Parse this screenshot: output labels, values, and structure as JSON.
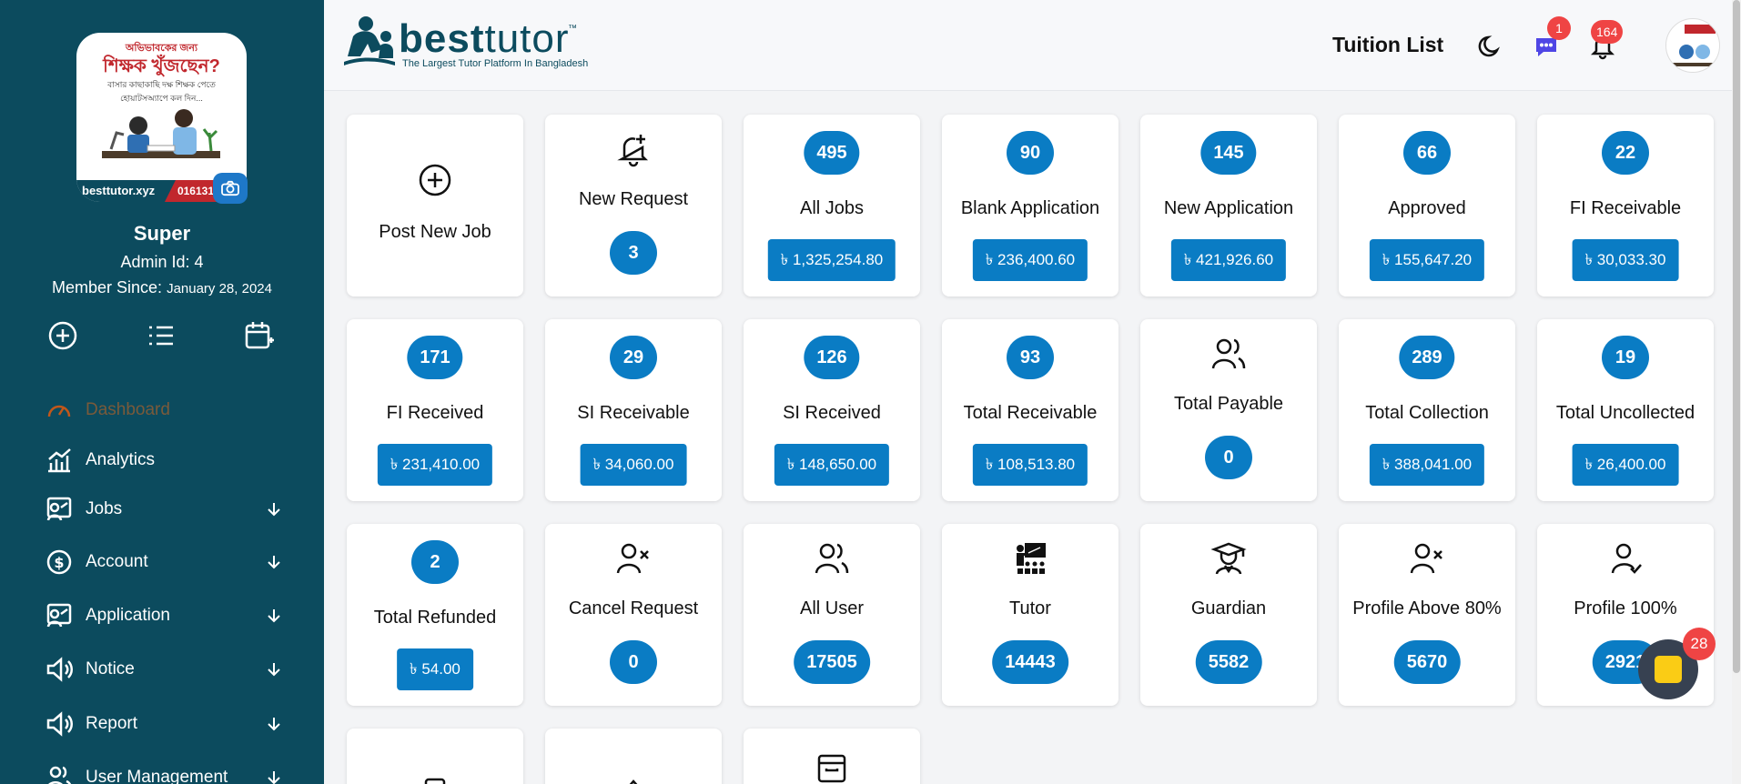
{
  "sidebar": {
    "photo": {
      "headline": "অভিভাবকের জন্য",
      "title": "শিক্ষক খুঁজছেন?",
      "subtitle": "বাসার কাছাকাছি দক্ষ শিক্ষক পেতে হোয়াটসঅ্যাপে কল দিন...",
      "site": "besttutor.xyz",
      "phone": "016131"
    },
    "user_name": "Super",
    "admin_id": "Admin Id: 4",
    "member_since_label": "Member Since:",
    "member_since_date": "January 28, 2024",
    "quick_icons": [
      "plus-circle-icon",
      "list-icon",
      "calendar-plus-icon"
    ],
    "nav": [
      {
        "label": "Dashboard",
        "icon": "gauge-icon",
        "expandable": false
      },
      {
        "label": "Analytics",
        "icon": "chart-bar-icon",
        "expandable": false
      },
      {
        "label": "Jobs",
        "icon": "tutor-board-icon",
        "expandable": true
      },
      {
        "label": "Account",
        "icon": "dollar-circle-icon",
        "expandable": true
      },
      {
        "label": "Application",
        "icon": "tutor-board-icon",
        "expandable": true
      },
      {
        "label": "Notice",
        "icon": "speaker-icon",
        "expandable": true
      },
      {
        "label": "Report",
        "icon": "speaker-icon",
        "expandable": true
      },
      {
        "label": "User Management",
        "icon": "users-icon",
        "expandable": true
      }
    ],
    "active_color": "#7a5a3a",
    "bg_color": "#0c4b5e"
  },
  "header": {
    "logo_bold": "best",
    "logo_light": "tutor",
    "logo_tm": "™",
    "logo_tagline": "The Largest Tutor Platform In Bangladesh",
    "tuition_list": "Tuition List",
    "chat_badge": "1",
    "notification_badge": "164"
  },
  "currency_symbol": "৳",
  "accent_color": "#0a7cc4",
  "cards": [
    {
      "title": "Post New Job",
      "icon": "plus-circle-icon"
    },
    {
      "title": "New Request",
      "icon": "bell-plus-icon",
      "count": "3"
    },
    {
      "title": "All Jobs",
      "count": "495",
      "amount": "৳ 1,325,254.80"
    },
    {
      "title": "Blank Application",
      "count": "90",
      "amount": "৳ 236,400.60"
    },
    {
      "title": "New Application",
      "count": "145",
      "amount": "৳ 421,926.60"
    },
    {
      "title": "Approved",
      "count": "66",
      "amount": "৳ 155,647.20"
    },
    {
      "title": "FI Receivable",
      "count": "22",
      "amount": "৳ 30,033.30"
    },
    {
      "title": "FI Received",
      "count": "171",
      "amount": "৳ 231,410.00"
    },
    {
      "title": "SI Receivable",
      "count": "29",
      "amount": "৳ 34,060.00"
    },
    {
      "title": "SI Received",
      "count": "126",
      "amount": "৳ 148,650.00"
    },
    {
      "title": "Total Receivable",
      "count": "93",
      "amount": "৳ 108,513.80"
    },
    {
      "title": "Total Payable",
      "icon": "users-icon",
      "count": "0"
    },
    {
      "title": "Total Collection",
      "count": "289",
      "amount": "৳ 388,041.00"
    },
    {
      "title": "Total Uncollected",
      "count": "19",
      "amount": "৳ 26,400.00"
    },
    {
      "title": "Total Refunded",
      "count": "2",
      "amount": "৳ 54.00"
    },
    {
      "title": "Cancel Request",
      "icon": "user-x-icon",
      "count": "0"
    },
    {
      "title": "All User",
      "icon": "users-icon",
      "count": "17505"
    },
    {
      "title": "Tutor",
      "icon": "teacher-board-icon",
      "count": "14443"
    },
    {
      "title": "Guardian",
      "icon": "graduation-cap-user-icon",
      "count": "5582"
    },
    {
      "title": "Profile Above 80%",
      "icon": "user-x-icon",
      "count": "5670"
    },
    {
      "title": "Profile 100%",
      "icon": "user-check-icon",
      "count": "2921"
    }
  ],
  "floating": {
    "sticky_badge": "28"
  }
}
